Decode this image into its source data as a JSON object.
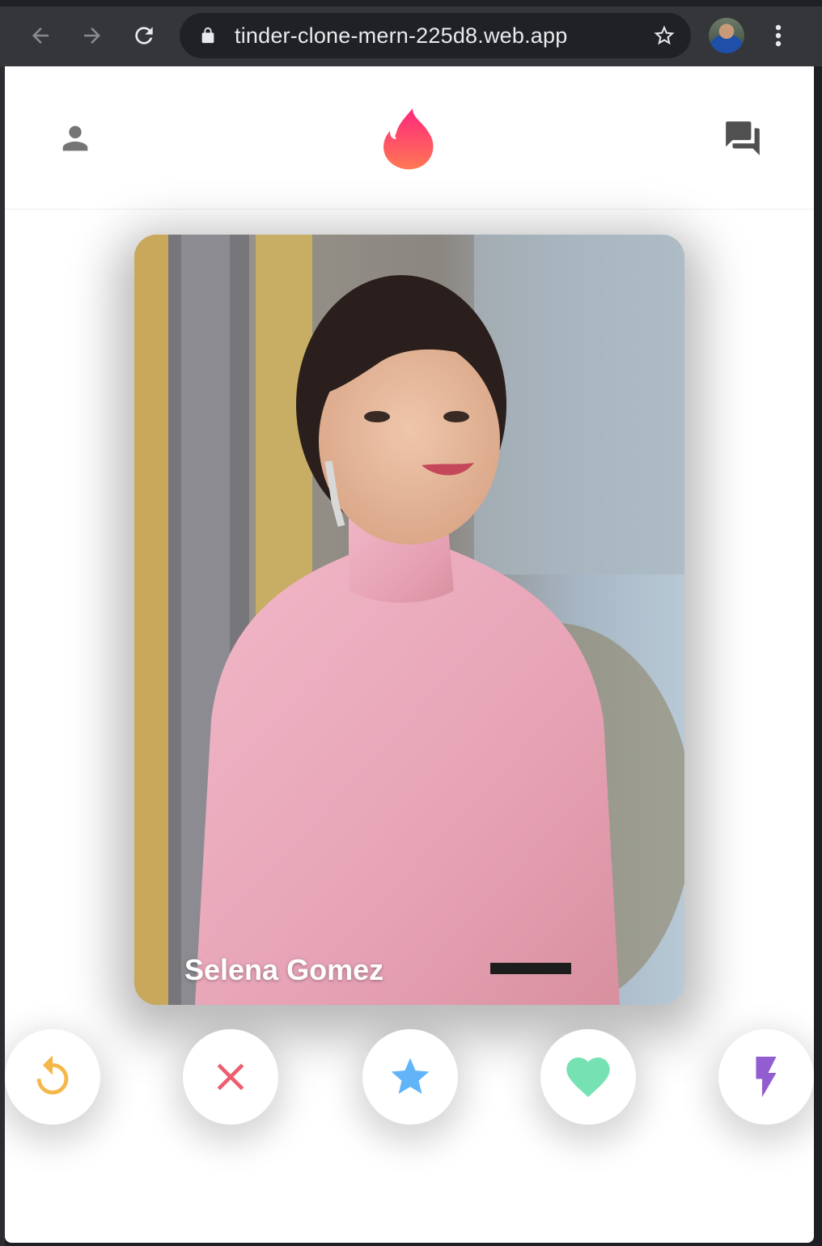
{
  "browser": {
    "url": "tinder-clone-mern-225d8.web.app",
    "icons": {
      "back": "arrow-left-icon",
      "forward": "arrow-right-icon",
      "reload": "reload-icon",
      "lock": "lock-icon",
      "bookmark": "star-outline-icon",
      "profile": "avatar",
      "menu": "vertical-dots-icon"
    }
  },
  "header": {
    "icons": {
      "profile": "person-icon",
      "logo": "tinder-flame-icon",
      "chats": "forum-icon"
    }
  },
  "card": {
    "name": "Selena Gomez"
  },
  "swipe_buttons": [
    {
      "icon": "replay-icon",
      "color": "#f5b748"
    },
    {
      "icon": "close-icon",
      "color": "#ec5e6f"
    },
    {
      "icon": "star-icon",
      "color": "#62b4f9"
    },
    {
      "icon": "heart-icon",
      "color": "#76e2b3"
    },
    {
      "icon": "flash-icon",
      "color": "#915dd1"
    }
  ],
  "colors": {
    "logo_gradient_start": "#fd267d",
    "logo_gradient_end": "#ff7854"
  }
}
